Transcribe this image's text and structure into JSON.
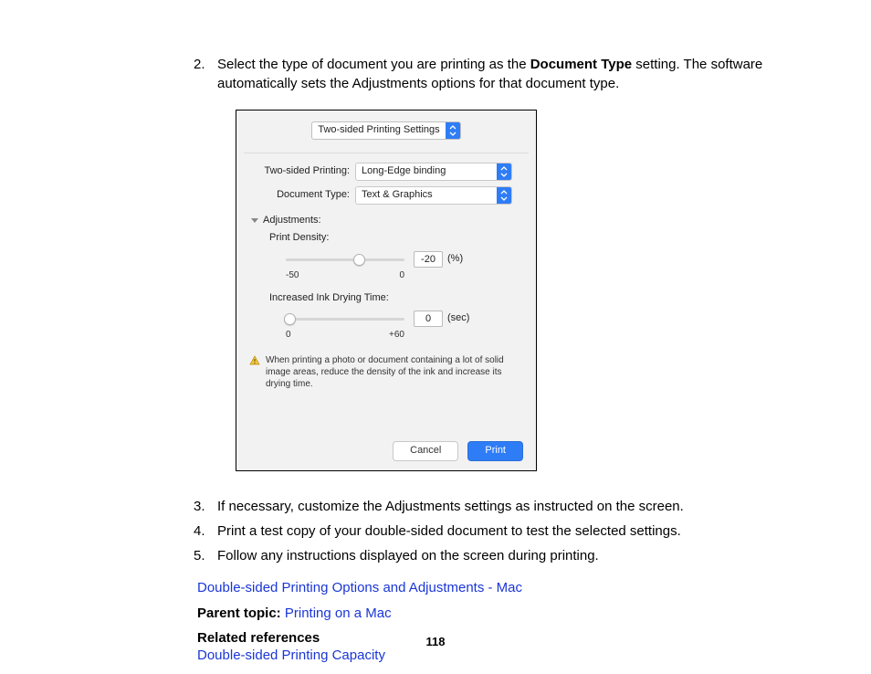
{
  "steps": {
    "s2_pre": "Select the type of document you are printing as the ",
    "s2_bold": "Document Type",
    "s2_post": " setting. The software automatically sets the Adjustments options for that document type.",
    "s3": "If necessary, customize the Adjustments settings as instructed on the screen.",
    "s4": "Print a test copy of your double-sided document to test the selected settings.",
    "s5": "Follow any instructions displayed on the screen during printing."
  },
  "nums": {
    "n2": "2.",
    "n3": "3.",
    "n4": "4.",
    "n5": "5."
  },
  "dialog": {
    "topSelect": "Two-sided Printing Settings",
    "twoSidedLabel": "Two-sided Printing:",
    "twoSidedValue": "Long-Edge binding",
    "docTypeLabel": "Document Type:",
    "docTypeValue": "Text & Graphics",
    "adjustments": "Adjustments:",
    "printDensity": "Print Density:",
    "densityMin": "-50",
    "densityMax": "0",
    "densityValue": "-20",
    "densityUnit": "(%)",
    "dryLabel": "Increased Ink Drying Time:",
    "dryMin": "0",
    "dryMax": "+60",
    "dryValue": "0",
    "dryUnit": "(sec)",
    "warning": "When printing a photo or document containing a lot of solid image areas, reduce the density of the ink and increase its drying time.",
    "cancel": "Cancel",
    "print": "Print"
  },
  "links": {
    "subtopic": "Double-sided Printing Options and Adjustments - Mac",
    "parentLabel": "Parent topic:",
    "parentLink": "Printing on a Mac",
    "refsHead": "Related references",
    "refLink": "Double-sided Printing Capacity"
  },
  "pageNumber": "118"
}
